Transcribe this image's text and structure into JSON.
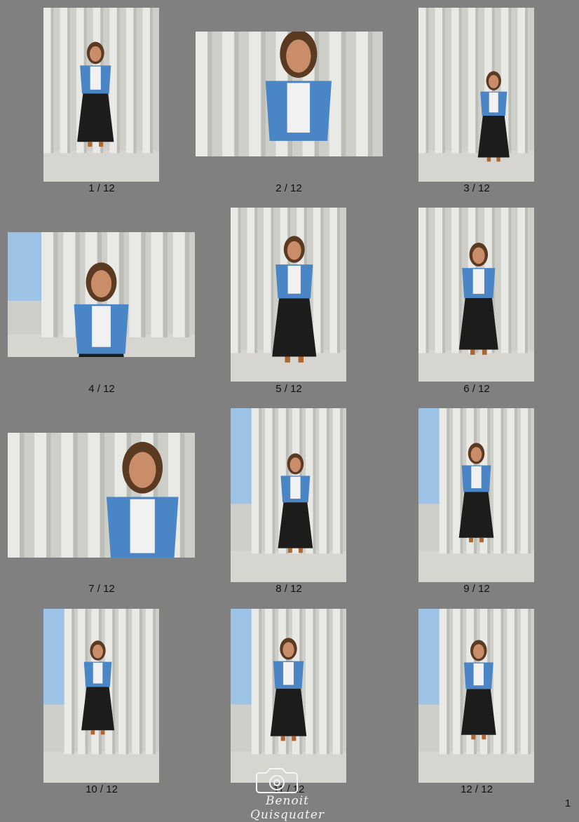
{
  "page": {
    "number": "1"
  },
  "watermark": {
    "text": "Benoit Quisquater",
    "icon": "camera-icon"
  },
  "photos": [
    {
      "caption": "1 / 12"
    },
    {
      "caption": "2 / 12"
    },
    {
      "caption": "3 / 12"
    },
    {
      "caption": "4 / 12"
    },
    {
      "caption": "5 / 12"
    },
    {
      "caption": "6 / 12"
    },
    {
      "caption": "7 / 12"
    },
    {
      "caption": "8 / 12"
    },
    {
      "caption": "9 / 12"
    },
    {
      "caption": "10 / 12"
    },
    {
      "caption": "11 / 12"
    },
    {
      "caption": "12 / 12"
    }
  ],
  "colors": {
    "background": "#808080",
    "column": "#e9e9e6",
    "column_shadow": "#bdbdb8",
    "sky": "#9cc3e6",
    "pavement": "#d7d5d0",
    "jacket": "#4a86c5",
    "skirt": "#1c1c1c",
    "skin": "#c98d6a",
    "hair": "#5b3a22"
  }
}
